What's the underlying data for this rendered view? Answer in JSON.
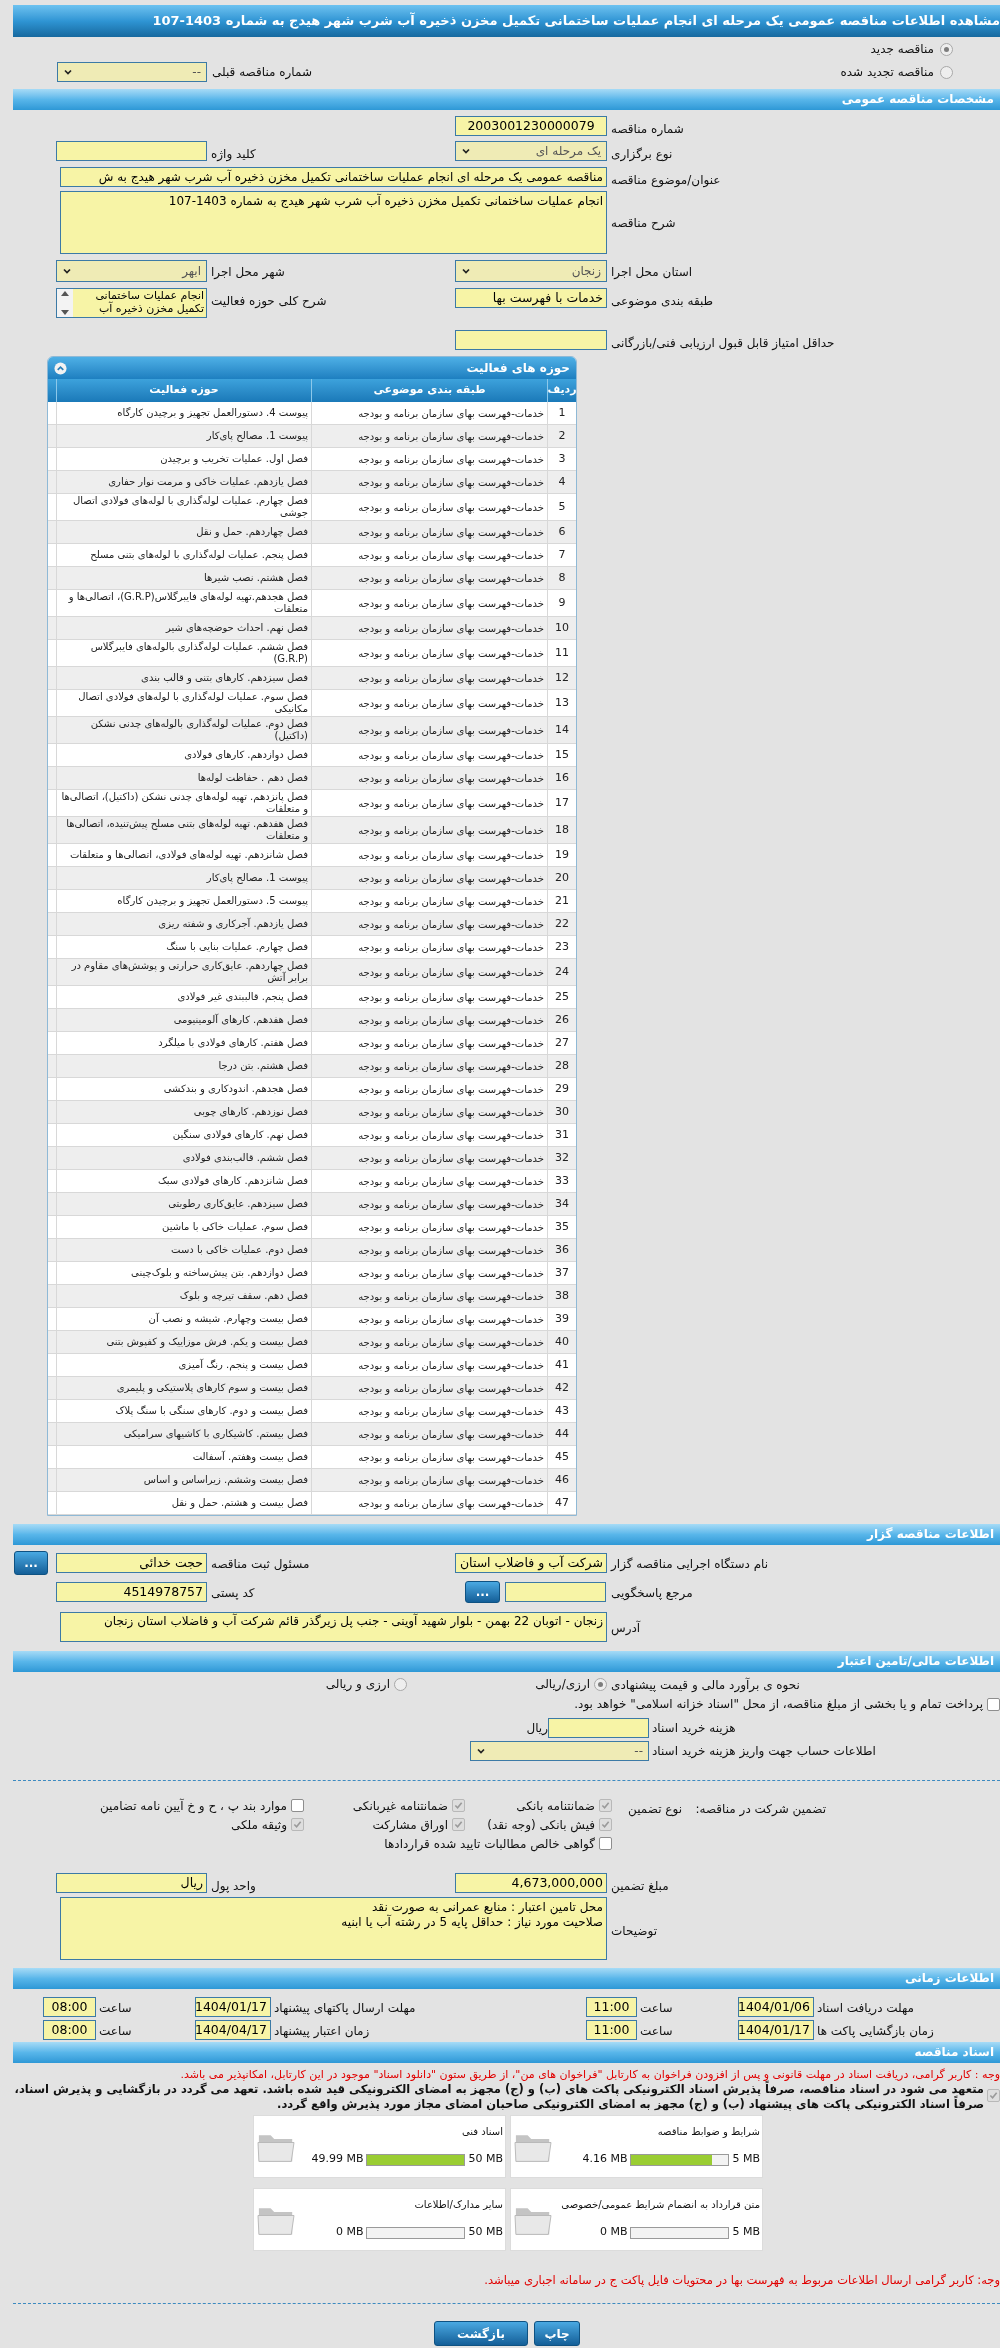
{
  "title": "مشاهده اطلاعات مناقصه عمومی یک مرحله ای انجام عملیات ساختمانی تکمیل مخزن ذخیره آب شرب شهر هیدج به شماره 1403-107",
  "tender_type": [
    {
      "label": "مناقصه جدید",
      "selected": true
    },
    {
      "label": "مناقصه تجدید شده",
      "selected": false
    }
  ],
  "previous_tender": {
    "label": "شماره مناقصه قبلی",
    "value": "--"
  },
  "general": {
    "header": "مشخصات مناقصه عمومی",
    "tender_number": {
      "label": "شماره مناقصه",
      "value": "2003001230000079"
    },
    "holding_type": {
      "label": "نوع برگزاری",
      "value": "یک مرحله ای"
    },
    "keyword": {
      "label": "کلید واژه"
    },
    "subject": {
      "label": "عنوان/موضوع مناقصه",
      "value": "مناقصه عمومی یک مرحله ای انجام عملیات ساختمانی تکمیل مخزن ذخیره آب شرب شهر هیدج به ش"
    },
    "description": {
      "label": "شرح مناقصه",
      "value": "انجام عملیات ساختمانی تکمیل مخزن ذخیره آب شرب شهر هیدج به شماره 1403-107"
    },
    "province": {
      "label": "استان محل اجرا",
      "value": "زنجان"
    },
    "city": {
      "label": "شهر محل اجرا",
      "value": "ابهر"
    },
    "category": {
      "label": "طبقه بندی موضوعی",
      "value": "خدمات با فهرست بها"
    },
    "activity_summary": {
      "label": "شرح کلی حوزه فعالیت",
      "value": "انجام عملیات ساختمانی تکمیل مخزن ذخیره آب"
    },
    "min_score": {
      "label": "حداقل امتیاز قابل قبول ارزیابی فنی/بازرگانی"
    }
  },
  "activities": {
    "header": "حوزه های فعالیت",
    "columns": [
      "ردیف",
      "طبقه بندی موضوعی",
      "حوزه فعالیت"
    ],
    "rows": [
      {
        "number": "1",
        "category": "خدمات-فهرست بهای سازمان برنامه و بودجه",
        "activity": "پیوست 4. دستورالعمل تجهیز و برچیدن کارگاه"
      },
      {
        "number": "2",
        "category": "خدمات-فهرست بهای سازمان برنامه و بودجه",
        "activity": "پیوست 1. مصالح پای‌کار"
      },
      {
        "number": "3",
        "category": "خدمات-فهرست بهای سازمان برنامه و بودجه",
        "activity": "فصل اول. عملیات تخریب و برچیدن"
      },
      {
        "number": "4",
        "category": "خدمات-فهرست بهای سازمان برنامه و بودجه",
        "activity": "فصل یازدهم. عملیات خاکی و مرمت نوار حفاری"
      },
      {
        "number": "5",
        "category": "خدمات-فهرست بهای سازمان برنامه و بودجه",
        "activity": "فصل چهارم. عملیات لوله‌گذاری با لوله‌های فولادی اتصال جوشی"
      },
      {
        "number": "6",
        "category": "خدمات-فهرست بهای سازمان برنامه و بودجه",
        "activity": "فصل چهاردهم. حمل و نقل"
      },
      {
        "number": "7",
        "category": "خدمات-فهرست بهای سازمان برنامه و بودجه",
        "activity": "فصل پنجم. عملیات لوله‌گذاری با لوله‌های بتنی مسلح"
      },
      {
        "number": "8",
        "category": "خدمات-فهرست بهای سازمان برنامه و بودجه",
        "activity": "فصل هشتم. نصب شیرها"
      },
      {
        "number": "9",
        "category": "خدمات-فهرست بهای سازمان برنامه و بودجه",
        "activity": "فصل هجدهم.تهیه لوله‌های فایبرگلاس(G.R.P)، اتصالی‌ها و متعلقات"
      },
      {
        "number": "10",
        "category": "خدمات-فهرست بهای سازمان برنامه و بودجه",
        "activity": "فصل نهم. احداث حوضچه‌های شیر"
      },
      {
        "number": "11",
        "category": "خدمات-فهرست بهای سازمان برنامه و بودجه",
        "activity": "فصل ششم. عملیات لوله‌گذاری بالوله‌های فایبرگلاس (G.R.P)"
      },
      {
        "number": "12",
        "category": "خدمات-فهرست بهای سازمان برنامه و بودجه",
        "activity": "فصل سیزدهم. کارهای بتنی و قالب بندی"
      },
      {
        "number": "13",
        "category": "خدمات-فهرست بهای سازمان برنامه و بودجه",
        "activity": "فصل سوم. عملیات لوله‌گذاری با لوله‌های فولادی اتصال مکانیکی"
      },
      {
        "number": "14",
        "category": "خدمات-فهرست بهای سازمان برنامه و بودجه",
        "activity": "فصل دوم. عملیات لوله‌گذاری بالوله‌های چدنی نشکن (داکتیل)"
      },
      {
        "number": "15",
        "category": "خدمات-فهرست بهای سازمان برنامه و بودجه",
        "activity": "فصل دوازدهم. کارهای فولادی"
      },
      {
        "number": "16",
        "category": "خدمات-فهرست بهای سازمان برنامه و بودجه",
        "activity": "فصل دهم . حفاظت لوله‌ها"
      },
      {
        "number": "17",
        "category": "خدمات-فهرست بهای سازمان برنامه و بودجه",
        "activity": "فصل پانزدهم. تهیه لوله‌های چدنی نشکن (داکتیل)، اتصالی‌ها و متعلقات"
      },
      {
        "number": "18",
        "category": "خدمات-فهرست بهای سازمان برنامه و بودجه",
        "activity": "فصل هفدهم. تهیه لوله‌های بتنی مسلح پیش‌تنیده، اتصالی‌ها و متعلقات"
      },
      {
        "number": "19",
        "category": "خدمات-فهرست بهای سازمان برنامه و بودجه",
        "activity": "فصل شانزدهم. تهیه لوله‌های فولادی، اتصالی‌ها و متعلقات"
      },
      {
        "number": "20",
        "category": "خدمات-فهرست بهای سازمان برنامه و بودجه",
        "activity": "پیوست 1. مصالح پای‌کار"
      },
      {
        "number": "21",
        "category": "خدمات-فهرست بهای سازمان برنامه و بودجه",
        "activity": "پیوست 5. دستورالعمل تجهیز و برچیدن کارگاه"
      },
      {
        "number": "22",
        "category": "خدمات-فهرست بهای سازمان برنامه و بودجه",
        "activity": "فصل یازدهم. آجرکاری و شفته ریزی"
      },
      {
        "number": "23",
        "category": "خدمات-فهرست بهای سازمان برنامه و بودجه",
        "activity": "فصل چهارم. عملیات بنایی با سنگ"
      },
      {
        "number": "24",
        "category": "خدمات-فهرست بهای سازمان برنامه و بودجه",
        "activity": "فصل چهاردهم. عایق‌کاری حرارتی و پوشش‌های مقاوم در برابر آتش"
      },
      {
        "number": "25",
        "category": "خدمات-فهرست بهای سازمان برنامه و بودجه",
        "activity": "فصل پنجم. قالببندی غیر فولادی"
      },
      {
        "number": "26",
        "category": "خدمات-فهرست بهای سازمان برنامه و بودجه",
        "activity": "فصل هفدهم. کارهای آلومینیومی"
      },
      {
        "number": "27",
        "category": "خدمات-فهرست بهای سازمان برنامه و بودجه",
        "activity": "فصل هفتم. کارهای فولادی با میلگرد"
      },
      {
        "number": "28",
        "category": "خدمات-فهرست بهای سازمان برنامه و بودجه",
        "activity": "فصل هشتم. بتن درجا"
      },
      {
        "number": "29",
        "category": "خدمات-فهرست بهای سازمان برنامه و بودجه",
        "activity": "فصل هجدهم. اندودکاری و بندکشی"
      },
      {
        "number": "30",
        "category": "خدمات-فهرست بهای سازمان برنامه و بودجه",
        "activity": "فصل نوزدهم. کارهای چوبی"
      },
      {
        "number": "31",
        "category": "خدمات-فهرست بهای سازمان برنامه و بودجه",
        "activity": "فصل نهم. کارهای فولادی سنگین"
      },
      {
        "number": "32",
        "category": "خدمات-فهرست بهای سازمان برنامه و بودجه",
        "activity": "فصل ششم. قالب‌بندی فولادی"
      },
      {
        "number": "33",
        "category": "خدمات-فهرست بهای سازمان برنامه و بودجه",
        "activity": "فصل شانزدهم. کارهای فولادی سبک"
      },
      {
        "number": "34",
        "category": "خدمات-فهرست بهای سازمان برنامه و بودجه",
        "activity": "فصل سیزدهم. عایق‌کاری رطوبتی"
      },
      {
        "number": "35",
        "category": "خدمات-فهرست بهای سازمان برنامه و بودجه",
        "activity": "فصل سوم. عملیات خاکی با ماشین"
      },
      {
        "number": "36",
        "category": "خدمات-فهرست بهای سازمان برنامه و بودجه",
        "activity": "فصل دوم. عملیات خاکی با دست"
      },
      {
        "number": "37",
        "category": "خدمات-فهرست بهای سازمان برنامه و بودجه",
        "activity": "فصل دوازدهم. بتن پیش‌ساخته و بلوک‌چینی"
      },
      {
        "number": "38",
        "category": "خدمات-فهرست بهای سازمان برنامه و بودجه",
        "activity": "فصل دهم. سقف تیرچه و بلوک"
      },
      {
        "number": "39",
        "category": "خدمات-فهرست بهای سازمان برنامه و بودجه",
        "activity": "فصل بیست وچهارم. شیشه و نصب آن"
      },
      {
        "number": "40",
        "category": "خدمات-فهرست بهای سازمان برنامه و بودجه",
        "activity": "فصل بیست و یکم. فرش موزاییک و کفپوش بتنی"
      },
      {
        "number": "41",
        "category": "خدمات-فهرست بهای سازمان برنامه و بودجه",
        "activity": "فصل بیست و پنجم. رنگ آمیزی"
      },
      {
        "number": "42",
        "category": "خدمات-فهرست بهای سازمان برنامه و بودجه",
        "activity": "فصل بیست و سوم کارهای پلاستیکی و پلیمری"
      },
      {
        "number": "43",
        "category": "خدمات-فهرست بهای سازمان برنامه و بودجه",
        "activity": "فصل بیست و دوم. کارهای سنگی با سنگ پلاک"
      },
      {
        "number": "44",
        "category": "خدمات-فهرست بهای سازمان برنامه و بودجه",
        "activity": "فصل بیستم. کاشیکاری با کاشیهای سرامیکی"
      },
      {
        "number": "45",
        "category": "خدمات-فهرست بهای سازمان برنامه و بودجه",
        "activity": "فصل بیست وهفتم. آسفالت"
      },
      {
        "number": "46",
        "category": "خدمات-فهرست بهای سازمان برنامه و بودجه",
        "activity": "فصل بیست وششم. زیراساس و اساس"
      },
      {
        "number": "47",
        "category": "خدمات-فهرست بهای سازمان برنامه و بودجه",
        "activity": "فصل بیست و هشتم. حمل و نقل"
      }
    ]
  },
  "organizer": {
    "header": "اطلاعات مناقصه گزار",
    "agency": {
      "label": "نام دستگاه اجرایی مناقصه گزار",
      "value": "شرکت آب و فاضلاب استان"
    },
    "registrar": {
      "label": "مسئول ثبت مناقصه",
      "value": "حجت خدائی",
      "button": "..."
    },
    "reference": {
      "label": "مرجع پاسخگویی",
      "button": "..."
    },
    "postal_code": {
      "label": "کد پستی",
      "value": "4514978757"
    },
    "address": {
      "label": "آدرس",
      "value": "زنجان - اتوبان 22 بهمن - بلوار شهید آوینی - جنب پل زیرگذر قائم شرکت آب و فاضلاب استان زنجان"
    }
  },
  "finance": {
    "header": "اطلاعات مالی/تامین اعتبار",
    "estimate": {
      "label": "نحوه ی برآورد مالی و قیمت پیشنهادی",
      "options": [
        {
          "label": "ارزی/ریالی",
          "selected": true
        },
        {
          "label": "ارزی و ریالی",
          "selected": false
        }
      ]
    },
    "treasury": {
      "label": "پرداخت تمام و یا بخشی از مبلغ مناقصه، از محل \"اسناد خزانه اسلامی\" خواهد بود.",
      "checked": false
    },
    "doc_cost": {
      "label": "هزینه خرید اسناد",
      "unit": "ریال"
    },
    "account": {
      "label": "اطلاعات حساب جهت واریز هزینه خرید اسناد",
      "value": "--"
    },
    "guarantee": {
      "label": "تضمین شرکت در مناقصه:",
      "type_label": "نوع تضمین",
      "options": [
        {
          "label": "ضمانتنامه بانکی",
          "checked": true
        },
        {
          "label": "ضمانتنامه غیربانکی",
          "checked": true
        },
        {
          "label": "موارد بند پ ، ح و خ آیین نامه تضامین",
          "checked": false
        },
        {
          "label": "فیش بانکی (وجه نقد)",
          "checked": true
        },
        {
          "label": "اوراق مشارکت",
          "checked": true
        },
        {
          "label": "وثیقه ملکی",
          "checked": true
        },
        {
          "label": "گواهی خالص مطالبات تایید شده قراردادها",
          "checked": false
        }
      ]
    },
    "amount": {
      "label": "مبلغ تضمین",
      "value": "4,673,000,000"
    },
    "currency": {
      "label": "واحد پول",
      "value": "ریال"
    },
    "notes": {
      "label": "توضیحات",
      "value": "محل تامین اعتبار : منابع عمرانی به صورت نقد\nصلاحیت مورد نیاز : حداقل پایه 5 در رشته آب یا ابنیه"
    }
  },
  "timing": {
    "header": "اطلاعات زمانی",
    "entries": [
      {
        "label": "مهلت دریافت اسناد",
        "date": "1404/01/06",
        "time_label": "ساعت",
        "time": "11:00"
      },
      {
        "label": "مهلت ارسال پاکتهای پیشنهاد",
        "date": "1404/01/17",
        "time_label": "ساعت",
        "time": "08:00"
      },
      {
        "label": "زمان بازگشایی پاکت ها",
        "date": "1404/01/17",
        "time_label": "ساعت",
        "time": "11:00"
      },
      {
        "label": "زمان اعتبار پیشنهاد",
        "date": "1404/04/17",
        "time_label": "ساعت",
        "time": "08:00"
      }
    ]
  },
  "documents": {
    "header": "اسناد مناقصه",
    "notice": "وجه : کاربر گرامی، دریافت اسناد در مهلت قانونی و پس از افزودن فراخوان به کارتابل \"فراخوان های من\"، از طریق ستون \"دانلود اسناد\" موجود در این کارتابل، امکانپذیر می باشد.",
    "commitment": {
      "text": "متعهد می شود در اسناد مناقصه، صرفاً پذیرش اسناد الکترونیکی پاکت های (ب) و (ج) مجهز به امضای الکترونیکی قید شده باشد. تعهد می گردد در بازگشایی و پذیرش اسناد، صرفاً اسناد الکترونیکی پاکت های پیشنهاد (ب) و (ج) مجهز به امضای الکترونیکی صاحبان امضای مجاز مورد پذیرش واقع گردد.",
      "checked": true
    },
    "files": [
      {
        "title": "شرایط و ضوابط مناقصه",
        "used": "4.16 MB",
        "total": "5 MB",
        "level": 0.832
      },
      {
        "title": "اسناد فنی",
        "used": "49.99 MB",
        "total": "50 MB",
        "level": 0.9998
      },
      {
        "title": "متن قرارداد به انضمام شرایط عمومی/خصوصی",
        "used": "0 MB",
        "total": "5 MB",
        "level": 0
      },
      {
        "title": "سایر مدارک/اطلاعات",
        "used": "0 MB",
        "total": "50 MB",
        "level": 0
      }
    ],
    "footer_note": "وجه: کاربر گرامی ارسال اطلاعات مربوط به فهرست بها در محتویات فایل پاکت ج در سامانه اجباری میباشد."
  },
  "buttons": [
    {
      "label": "چاپ"
    },
    {
      "label": "بازگشت"
    }
  ]
}
